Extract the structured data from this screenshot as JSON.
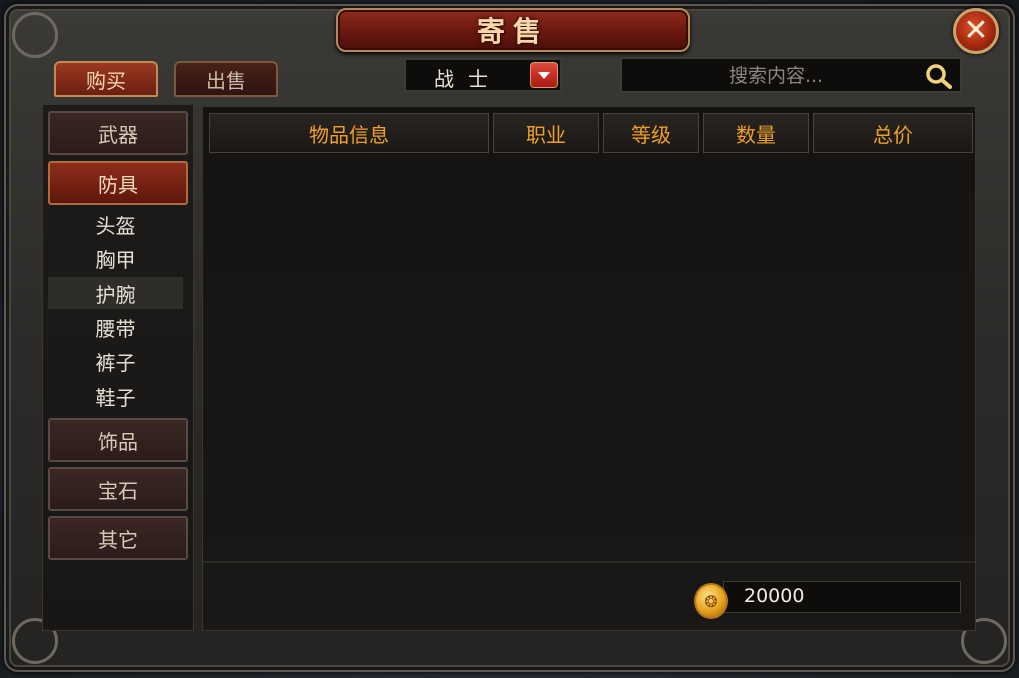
{
  "window": {
    "title": "寄售",
    "close_symbol": "✕"
  },
  "tabs": [
    {
      "label": "购买",
      "active": true
    },
    {
      "label": "出售",
      "active": false
    }
  ],
  "filter": {
    "class_value": "战士"
  },
  "search": {
    "placeholder": "搜索内容..."
  },
  "sidebar": {
    "categories": [
      {
        "label": "武器",
        "active": false
      },
      {
        "label": "防具",
        "active": true
      },
      {
        "label": "饰品",
        "active": false
      },
      {
        "label": "宝石",
        "active": false
      },
      {
        "label": "其它",
        "active": false
      }
    ],
    "subitems": [
      {
        "label": "头盔",
        "selected": false
      },
      {
        "label": "胸甲",
        "selected": false
      },
      {
        "label": "护腕",
        "selected": true
      },
      {
        "label": "腰带",
        "selected": false
      },
      {
        "label": "裤子",
        "selected": false
      },
      {
        "label": "鞋子",
        "selected": false
      }
    ]
  },
  "table": {
    "columns": [
      "物品信息",
      "职业",
      "等级",
      "数量",
      "总价"
    ],
    "rows": []
  },
  "footer": {
    "gold_amount": "20000"
  },
  "colors": {
    "accent_orange": "#f0a028",
    "title_red": "#8f2a1c",
    "gold": "#e4a21c"
  },
  "icons": {
    "close": "close-icon",
    "dropdown": "chevron-down-icon",
    "search": "search-icon",
    "coin": "gold-coin-icon"
  }
}
